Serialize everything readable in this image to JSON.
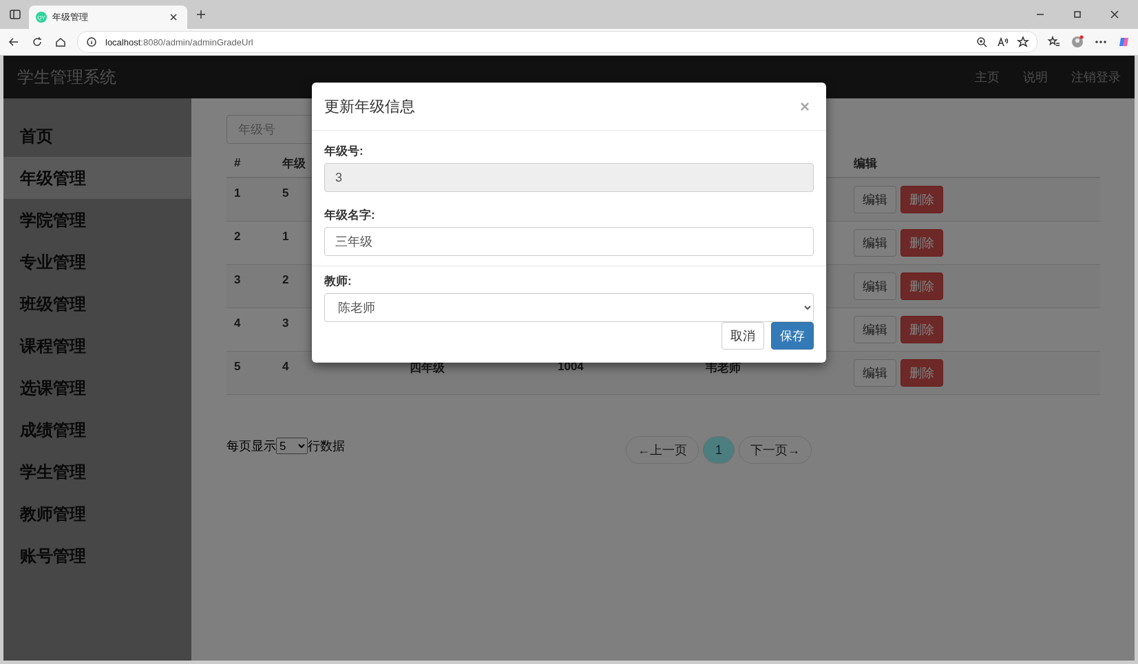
{
  "browser": {
    "tab_title": "年级管理",
    "tab_icon_text": "QY",
    "url_host": "localhost",
    "url_path": ":8080/admin/adminGradeUrl"
  },
  "navbar": {
    "brand": "学生管理系统",
    "links": [
      "主页",
      "说明",
      "注销登录"
    ]
  },
  "sidebar": {
    "items": [
      {
        "label": "首页",
        "selected": false
      },
      {
        "label": "年级管理",
        "selected": true
      },
      {
        "label": "学院管理",
        "selected": false
      },
      {
        "label": "专业管理",
        "selected": false
      },
      {
        "label": "班级管理",
        "selected": false
      },
      {
        "label": "课程管理",
        "selected": false
      },
      {
        "label": "选课管理",
        "selected": false
      },
      {
        "label": "成绩管理",
        "selected": false
      },
      {
        "label": "学生管理",
        "selected": false
      },
      {
        "label": "教师管理",
        "selected": false
      },
      {
        "label": "账号管理",
        "selected": false
      }
    ]
  },
  "search": {
    "placeholder": "年级号"
  },
  "table": {
    "columns": {
      "index": "#",
      "column_2": "年级",
      "actions": "编辑"
    },
    "rows": [
      {
        "index": "1",
        "column_2": "5",
        "actions": [
          {
            "label": "编辑",
            "kind": "default"
          },
          {
            "label": "删除",
            "kind": "danger"
          }
        ]
      },
      {
        "index": "2",
        "column_2": "1",
        "actions": [
          {
            "label": "编辑",
            "kind": "default"
          },
          {
            "label": "删除",
            "kind": "danger"
          }
        ]
      },
      {
        "index": "3",
        "column_2": "2",
        "actions": [
          {
            "label": "编辑",
            "kind": "default"
          },
          {
            "label": "删除",
            "kind": "danger"
          }
        ]
      },
      {
        "index": "4",
        "column_2": "3",
        "actions": [
          {
            "label": "编辑",
            "kind": "default"
          },
          {
            "label": "删除",
            "kind": "danger"
          }
        ]
      },
      {
        "index": "5",
        "column_2": "4",
        "column_3": "四年级",
        "column_4": "1004",
        "column_5": "韦老师",
        "actions": [
          {
            "label": "编辑",
            "kind": "default"
          },
          {
            "label": "删除",
            "kind": "danger"
          }
        ]
      }
    ]
  },
  "pagination": {
    "size_label_before": "每页显示",
    "page_size": "5",
    "size_label_after": "行数据",
    "prev": "←上一页",
    "pages": [
      {
        "label": "1",
        "selected": true
      }
    ],
    "next": "下一页→"
  },
  "modal": {
    "title": "更新年级信息",
    "close": "×",
    "fields": [
      {
        "label": "年级号:",
        "kind": "input",
        "value": "3",
        "disabled": true
      },
      {
        "label": "年级名字:",
        "kind": "input",
        "value": "三年级",
        "disabled": false
      },
      {
        "label": "教师:",
        "kind": "select",
        "value": "陈老师",
        "disabled": false
      }
    ],
    "buttons": [
      {
        "label": "取消",
        "kind": "default"
      },
      {
        "label": "保存",
        "kind": "primary"
      }
    ]
  }
}
